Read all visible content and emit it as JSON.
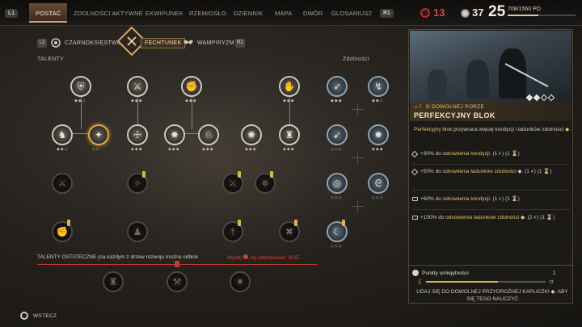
{
  "nav": {
    "left_key": "L1",
    "right_key": "R1",
    "tabs": [
      "POSTAĆ",
      "ZDOLNOŚCI AKTYWNE",
      "EKWIPUNEK",
      "RZEMIOSŁO",
      "DZIENNIK",
      "MAPA",
      "DWÓR",
      "GLOSARIUSZ"
    ],
    "active_tab": "POSTAĆ"
  },
  "stats": {
    "vitae_points": "13",
    "skill_points": "37",
    "level": "25",
    "xp": "708/1560 PD",
    "xp_fraction": 0.454
  },
  "trees": {
    "left_key": "L2",
    "right_key": "R2",
    "items": [
      "CZARNOKSIĘSTWO",
      "FECHTUNEK",
      "WAMPIRYZM"
    ],
    "active": "FECHTUNEK"
  },
  "sections": {
    "talents": "TALENTY",
    "abilities": "Zdolności"
  },
  "ultimate": {
    "text": "TALENTY OSTATECZNE (na każdym z drzew rozwoju można odblok",
    "cost_text": "Wydaj",
    "cost_suffix": ", by odblokować: 8/35"
  },
  "detail": {
    "subtitle": "O DOWOLNEJ PORZE",
    "title": "PERFEKCYJNY BLOK",
    "description_highlight": "Perfekcyjny blok",
    "description_rest": " przywraca więcej kondycji i ładunków zdolności",
    "page_dots": [
      true,
      true,
      false,
      false
    ],
    "upgrades": [
      {
        "pre": "+30% do ",
        "hl": "odnowienia kondycji",
        "post": ". (1 ◐) (1 ⌛)"
      },
      {
        "pre": "+50% do ",
        "hl": "odnowienia ładunków zdolności",
        "post": " ◆. (1 ◐) (1 ⌛)"
      },
      {
        "pre": "+60% do ",
        "hl": "odnowienia kondycji",
        "post": ". (1 ◐) (1 ⌛)"
      },
      {
        "pre": "+100% do ",
        "hl": "odnowienia ładunków zdolności",
        "post": " ◆. (2 ◐) (1 ⌛)"
      }
    ]
  },
  "skill_points_panel": {
    "label": "Punkty umiejętności",
    "value": "1",
    "progress": 0.6,
    "hint": "UDAJ SIĘ DO DOWOLNEJ PRZYDROŻNEJ KAPLICZKI ◆, ABY SIĘ TEGO NAUCZYĆ"
  },
  "footer": {
    "back_label": "WSTECZ"
  }
}
